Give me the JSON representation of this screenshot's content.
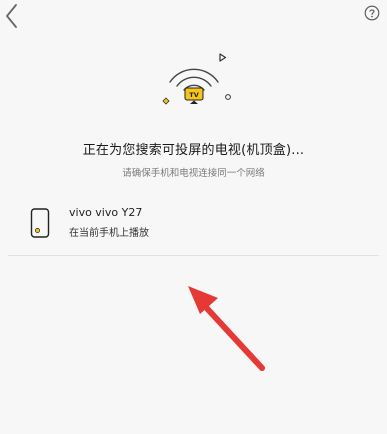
{
  "header": {
    "back_icon": "chevron-left-icon",
    "help_icon": "question-mark-icon"
  },
  "hero": {
    "badge_text": "TV",
    "icons": [
      "wifi-signal-icon",
      "tv-icon",
      "triangle-icon",
      "diamond-icon",
      "circle-icon"
    ],
    "accent_color": "#f5c518"
  },
  "main": {
    "title": "正在为您搜索可投屏的电视(机顶盒)...",
    "subtitle": "请确保手机和电视连接同一个网络"
  },
  "devices": [
    {
      "name": "vivo  vivo Y27",
      "status": "在当前手机上播放",
      "icon": "phone-icon"
    }
  ],
  "annotation": {
    "arrow_color": "#e53935"
  }
}
